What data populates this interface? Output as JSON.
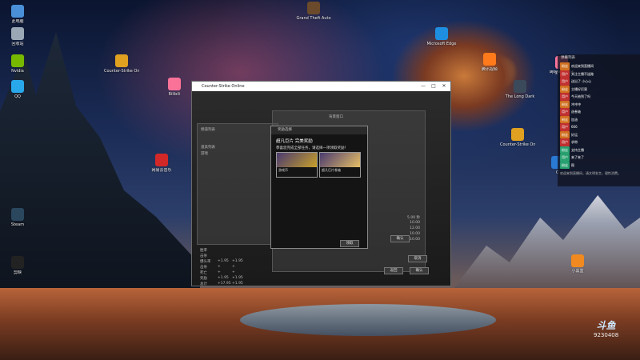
{
  "desktop": {
    "icons": [
      {
        "label": "此电脑",
        "color": "#4a90d9"
      },
      {
        "label": "回收站",
        "color": "#9aa7b5"
      },
      {
        "label": "Nvidia",
        "color": "#76b900"
      },
      {
        "label": "Microsoft Edge",
        "color": "#1e8fe0"
      },
      {
        "label": "Steam",
        "color": "#2a475e"
      },
      {
        "label": "Counter-Strike Online",
        "color": "#e0a020"
      },
      {
        "label": "Bilibili",
        "color": "#fb7299"
      },
      {
        "label": "QQ",
        "color": "#28a8ea"
      },
      {
        "label": "网易云音乐",
        "color": "#d22828"
      },
      {
        "label": "Grand Theft Auto",
        "color": "#6a4a2a"
      },
      {
        "label": "The Long Dark",
        "color": "#3a4a5a"
      },
      {
        "label": "腾讯视频",
        "color": "#ff7a1a"
      },
      {
        "label": "Counter-Strike Online",
        "color": "#e0a020"
      },
      {
        "label": "小黑盒",
        "color": "#f08a20"
      },
      {
        "label": "哔哩哔哩直播",
        "color": "#fb7299"
      },
      {
        "label": "Q",
        "color": "#2a7ad5"
      },
      {
        "label": "剪映",
        "color": "#222222"
      }
    ]
  },
  "game_window": {
    "title": "Counter-Strike Online",
    "controls": {
      "minimize": "—",
      "maximize": "□",
      "close": "✕"
    },
    "header_tab": "频道列表",
    "bg_dialog_title": "背景窗口",
    "menu_items": [
      "道具列表",
      "游戏"
    ],
    "stats": [
      {
        "label": "胜率",
        "a": "",
        "b": ""
      },
      {
        "label": "击杀",
        "a": "",
        "b": ""
      },
      {
        "label": "爆头率",
        "a": "+1.95",
        "b": "+1.95"
      },
      {
        "label": "击杀",
        "a": "+",
        "b": "+"
      },
      {
        "label": "死亡",
        "a": "+",
        "b": "+"
      },
      {
        "label": "奖励",
        "a": "+1.95",
        "b": "+1.95"
      },
      {
        "label": "总计",
        "a": "+17.95",
        "b": "+1.95"
      }
    ],
    "right_values": [
      "5.00 秒",
      "10.00",
      "12.00",
      "10.00",
      "10.00"
    ],
    "buttons": {
      "confirm": "确认",
      "cancel": "取消",
      "back": "返回",
      "ok": "确认"
    }
  },
  "dialog": {
    "title": "奖励选择",
    "heading": "超凡巨片 完美奖励",
    "prompt": "恭喜您完成全部任务，请选择一项领取奖励！",
    "options": [
      {
        "name": "游戏币",
        "sub": "1",
        "color": "#c7a02a"
      },
      {
        "name": "超凡巨片卷轴",
        "sub": "1",
        "color": "#e6c066"
      }
    ],
    "ok_label": "领取"
  },
  "chat": {
    "title": "弹幕列表",
    "messages": [
      {
        "badge": "粉丝",
        "badge_color": "#d07020",
        "text": "欢迎来到直播间"
      },
      {
        "badge": "用户",
        "badge_color": "#c03030",
        "text": "关注主播不迷路"
      },
      {
        "badge": "用户",
        "badge_color": "#c03030",
        "text": "送出了 小心心"
      },
      {
        "badge": "粉丝",
        "badge_color": "#d07020",
        "text": "主播好厉害"
      },
      {
        "badge": "用户",
        "badge_color": "#c03030",
        "text": "今天抽到了吗"
      },
      {
        "badge": "粉丝",
        "badge_color": "#d07020",
        "text": "冲冲冲"
      },
      {
        "badge": "用户",
        "badge_color": "#c03030",
        "text": "选卷轴"
      },
      {
        "badge": "粉丝",
        "badge_color": "#d07020",
        "text": "加油"
      },
      {
        "badge": "用户",
        "badge_color": "#c03030",
        "text": "666"
      },
      {
        "badge": "粉丝",
        "badge_color": "#d07020",
        "text": "好运"
      },
      {
        "badge": "用户",
        "badge_color": "#c03030",
        "text": "求带"
      },
      {
        "badge": "粉丝",
        "badge_color": "#28a070",
        "text": "支持主播"
      },
      {
        "badge": "用户",
        "badge_color": "#28a070",
        "text": "来了来了"
      },
      {
        "badge": "粉丝",
        "badge_color": "#28a070",
        "text": "稳"
      }
    ],
    "notice": "欢迎来到直播间，请文明发言，理性消费。"
  },
  "watermark": {
    "logo": "斗鱼",
    "id": "9230408"
  }
}
